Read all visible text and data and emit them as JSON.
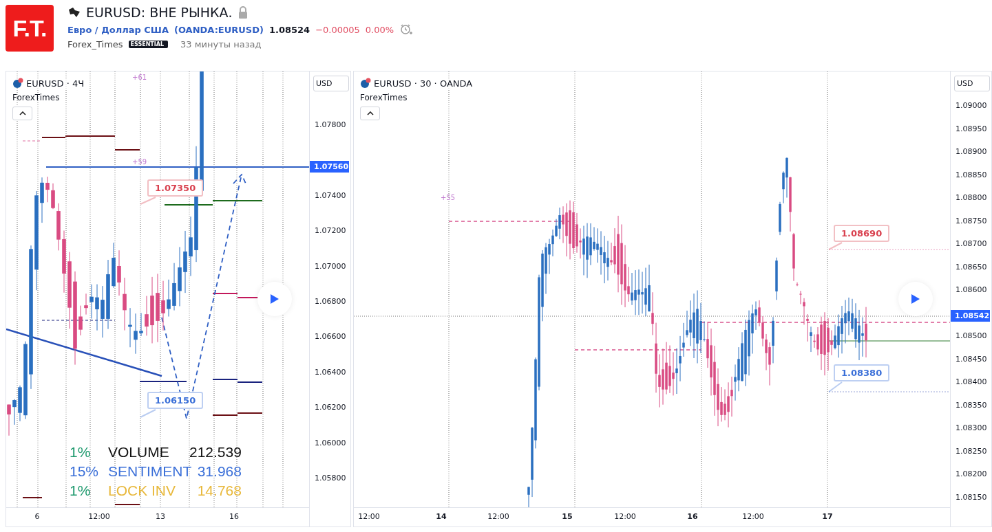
{
  "header": {
    "logo": "F.T.",
    "title": "EURUSD: ВНЕ РЫНКА.",
    "instrument": "Евро / Доллар США",
    "symbol": "(OANDA:EURUSD)",
    "price": "1.08524",
    "change": "−0.00005",
    "change_pct": "0.00%",
    "author": "Forex_Times",
    "badge": "ESSENTIAL",
    "time": "33 минуты назад"
  },
  "panels": [
    {
      "title": "EURUSD · 4Ч",
      "source": "ForexTimes",
      "currency": "USD",
      "last_price": "1.07560",
      "price_ticks": [
        "1.07800",
        "1.07400",
        "1.07200",
        "1.07000",
        "1.06800",
        "1.06600",
        "1.06400",
        "1.06200",
        "1.06000",
        "1.05800"
      ],
      "time_ticks": [
        {
          "label": "6",
          "kind": "day"
        },
        {
          "label": "12:00",
          "kind": "time"
        },
        {
          "label": "13",
          "kind": "day"
        },
        {
          "label": "16",
          "kind": "day"
        }
      ],
      "callouts": [
        {
          "label": "1.07350",
          "color": "#d9414f"
        },
        {
          "label": "1.06150",
          "color": "#3a6fd8"
        }
      ],
      "marks": [
        "+61",
        "+59"
      ],
      "stats": [
        {
          "pct": {
            "text": "1%",
            "color": "#1f9a6e"
          },
          "label": "VOLUME",
          "value": "212.539",
          "color": "#111111"
        },
        {
          "pct": {
            "text": "15%",
            "color": "#3a6fd8"
          },
          "label": "SENTIMENT",
          "value": "31.968",
          "color": "#3a6fd8"
        },
        {
          "pct": {
            "text": "1%",
            "color": "#1f9a6e"
          },
          "label": "LOCK INV",
          "value": "14.768",
          "color": "#e8b83a"
        }
      ]
    },
    {
      "title": "EURUSD · 30 · OANDA",
      "source": "ForexTimes",
      "currency": "USD",
      "last_price": "1.08542",
      "price_ticks": [
        "1.09000",
        "1.08950",
        "1.08900",
        "1.08850",
        "1.08800",
        "1.08750",
        "1.08700",
        "1.08650",
        "1.08600",
        "1.08500",
        "1.08450",
        "1.08400",
        "1.08350",
        "1.08300",
        "1.08250",
        "1.08200",
        "1.08150"
      ],
      "time_ticks": [
        {
          "label": "12:00",
          "kind": "time"
        },
        {
          "label": "14",
          "kind": "day"
        },
        {
          "label": "12:00",
          "kind": "time"
        },
        {
          "label": "15",
          "kind": "day"
        },
        {
          "label": "12:00",
          "kind": "time"
        },
        {
          "label": "16",
          "kind": "day"
        },
        {
          "label": "12:00",
          "kind": "time"
        },
        {
          "label": "17",
          "kind": "day"
        }
      ],
      "callouts": [
        {
          "label": "1.08690",
          "color": "#d9414f"
        },
        {
          "label": "1.08380",
          "color": "#3a6fd8"
        }
      ],
      "marks": [
        "+55"
      ]
    }
  ]
}
